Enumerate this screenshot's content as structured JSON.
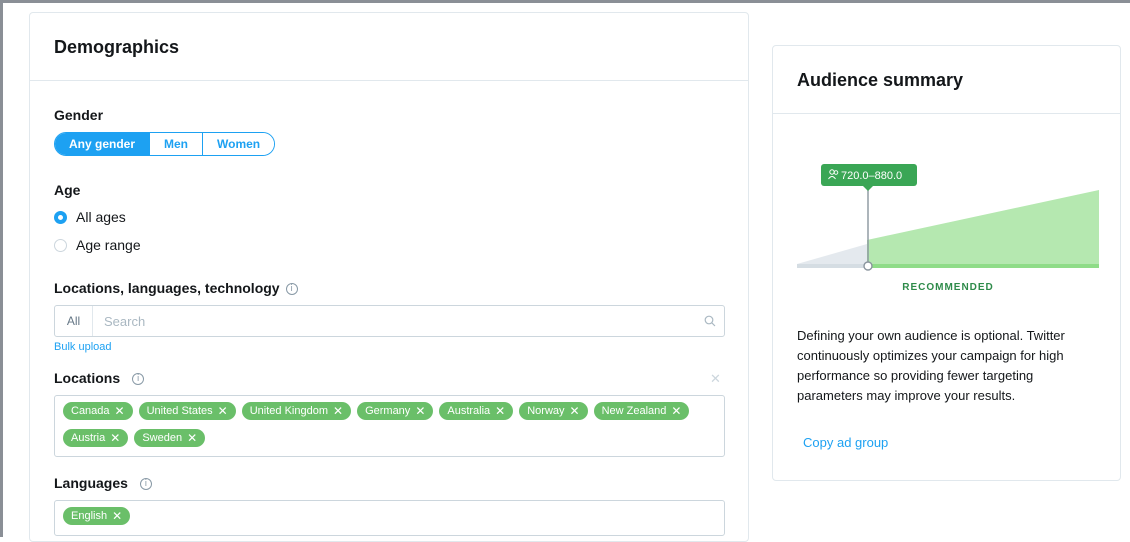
{
  "demographics": {
    "title": "Demographics",
    "gender": {
      "label": "Gender",
      "options": [
        "Any gender",
        "Men",
        "Women"
      ],
      "selected": "Any gender"
    },
    "age": {
      "label": "Age",
      "options": [
        "All ages",
        "Age range"
      ],
      "selected": "All ages"
    },
    "locations_languages": {
      "label": "Locations, languages, technology",
      "search_scope": "All",
      "search_placeholder": "Search",
      "bulk_upload": "Bulk upload"
    },
    "locations": {
      "label": "Locations",
      "tags": [
        "Canada",
        "United States",
        "United Kingdom",
        "Germany",
        "Australia",
        "Norway",
        "New Zealand",
        "Austria",
        "Sweden"
      ]
    },
    "languages": {
      "label": "Languages",
      "tags": [
        "English"
      ]
    }
  },
  "audience_summary": {
    "title": "Audience summary",
    "estimate": "720.0–880.0",
    "recommended_label": "RECOMMENDED",
    "description": "Defining your own audience is optional. Twitter continuously optimizes your campaign for high performance so providing fewer targeting parameters may improve your results.",
    "copy_link": "Copy ad group"
  },
  "colors": {
    "accent": "#1da1f2",
    "tag_green": "#6abf69",
    "chart_green": "#b5e8b0",
    "badge_green": "#3aa655"
  },
  "icons": [
    "info-icon",
    "search-icon",
    "close-icon",
    "people-icon"
  ]
}
